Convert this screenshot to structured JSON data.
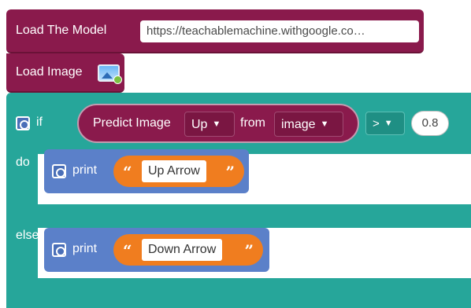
{
  "load_model": {
    "label": "Load The Model",
    "url_value": "https://teachablemachine.withgoogle.co…"
  },
  "load_image": {
    "label": "Load Image",
    "icon": "image-icon"
  },
  "if_block": {
    "if_label": "if",
    "do_label": "do",
    "else_label": "else",
    "predict": {
      "label": "Predict Image",
      "class_value": "Up",
      "from_label": "from",
      "source_value": "image"
    },
    "operator": ">",
    "threshold": "0.8"
  },
  "do_print": {
    "label": "print",
    "text": "Up Arrow"
  },
  "else_print": {
    "label": "print",
    "text": "Down Arrow"
  },
  "colors": {
    "ml_block": "#8a1a4c",
    "logic_block": "#26a69a",
    "print_block": "#5b80c9",
    "string_block": "#f07d1f"
  }
}
